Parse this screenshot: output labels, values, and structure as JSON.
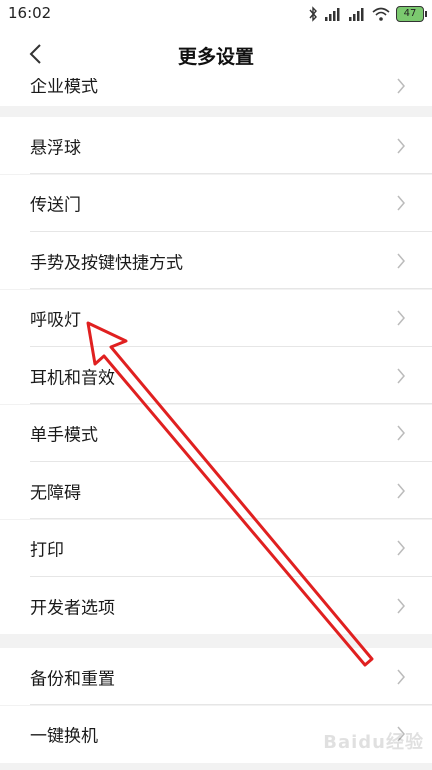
{
  "status": {
    "time": "16:02",
    "battery": "47"
  },
  "header": {
    "title": "更多设置"
  },
  "partial_item": {
    "label": "企业模式"
  },
  "group1": [
    {
      "label": "悬浮球"
    },
    {
      "label": "传送门"
    },
    {
      "label": "手势及按键快捷方式"
    },
    {
      "label": "呼吸灯"
    },
    {
      "label": "耳机和音效"
    },
    {
      "label": "单手模式"
    },
    {
      "label": "无障碍"
    },
    {
      "label": "打印"
    },
    {
      "label": "开发者选项"
    }
  ],
  "group2": [
    {
      "label": "备份和重置"
    },
    {
      "label": "一键换机"
    }
  ],
  "annotation": {
    "color": "#e02020"
  },
  "watermark": "Baidu经验"
}
